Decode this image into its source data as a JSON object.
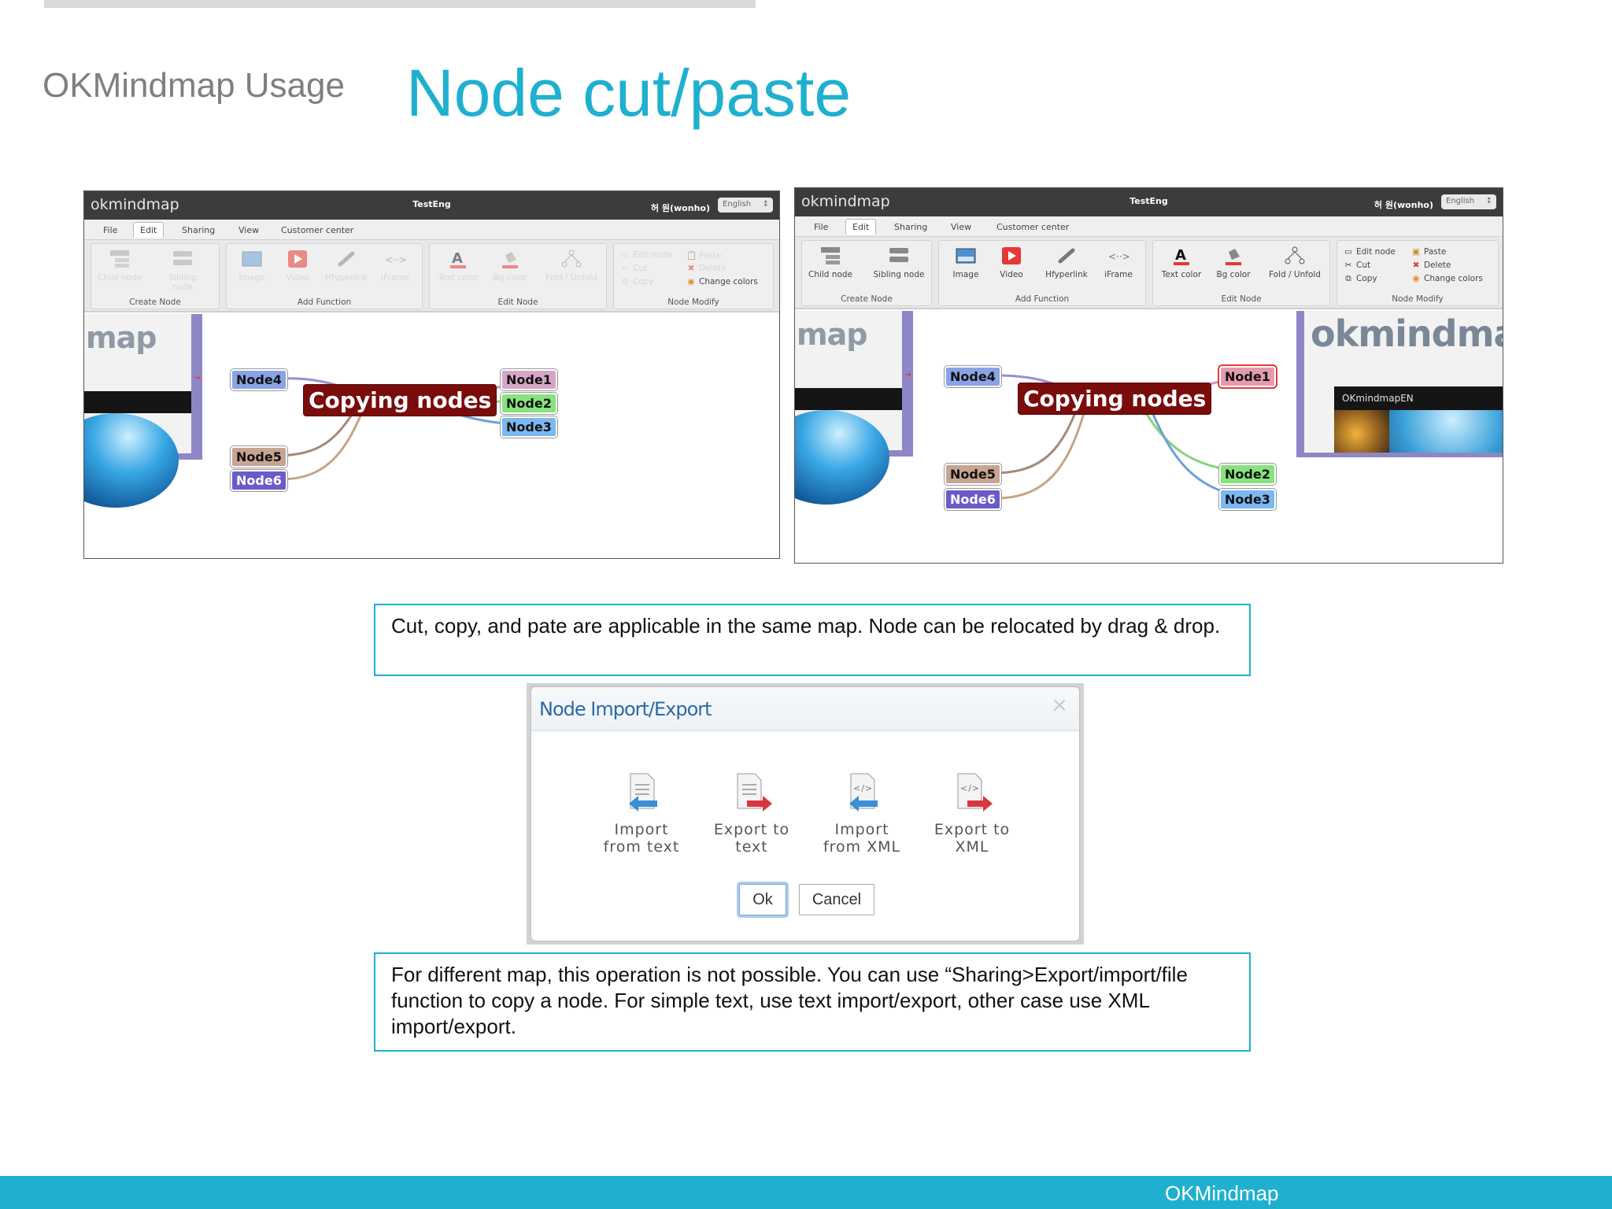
{
  "slide": {
    "section": "OKMindmap Usage",
    "title": "Node cut/paste",
    "footer": "OKMindmap"
  },
  "app": {
    "brand": "okmindmap",
    "doc_title": "TestEng",
    "user": "허 원(wonho)",
    "language": "English",
    "menu": [
      "File",
      "Edit",
      "Sharing",
      "View",
      "Customer center"
    ],
    "active_menu": "Edit",
    "groups": {
      "create_node": "Create Node",
      "add_function": "Add Function",
      "edit_node": "Edit Node",
      "node_modify": "Node Modify"
    },
    "tools": {
      "child_node": "Child node",
      "sibling_node": "Sibling node",
      "image": "Image",
      "video": "Video",
      "hyperlink": "Hfyperlink",
      "iframe": "iFrame",
      "text_color": "Text color",
      "bg_color": "Bg color",
      "fold_unfold": "Fold / Unfold",
      "edit_node": "Edit node",
      "paste": "Paste",
      "cut": "Cut",
      "delete": "Delete",
      "copy": "Copy",
      "change_colors": "Change colors"
    }
  },
  "mindmap": {
    "root": "Copying nodes",
    "nodes": [
      "Node1",
      "Node2",
      "Node3",
      "Node4",
      "Node5",
      "Node6"
    ],
    "panel_logo_left": "map",
    "panel_logo_right": "okmindmap",
    "panel_caption_right": "OKmindmapEN"
  },
  "callouts": {
    "same_map": "Cut, copy, and pate are applicable in the same map. Node can be relocated by drag & drop.",
    "different_map": "For different map, this operation is not possible. You can use “Sharing>Export/import/file function to copy a node. For simple text, use text import/export, other case use XML import/export."
  },
  "dialog": {
    "title": "Node Import/Export",
    "close": "×",
    "options": [
      {
        "line1": "Import",
        "line2": "from text",
        "icon": "import-text-icon"
      },
      {
        "line1": "Export to",
        "line2": "text",
        "icon": "export-text-icon"
      },
      {
        "line1": "Import",
        "line2": "from XML",
        "icon": "import-xml-icon"
      },
      {
        "line1": "Export to",
        "line2": "XML",
        "icon": "export-xml-icon"
      }
    ],
    "ok": "Ok",
    "cancel": "Cancel"
  },
  "colors": {
    "accent": "#1fb0cf",
    "root_node": "#7a0c0c",
    "dialog_title": "#2b6aa6"
  }
}
